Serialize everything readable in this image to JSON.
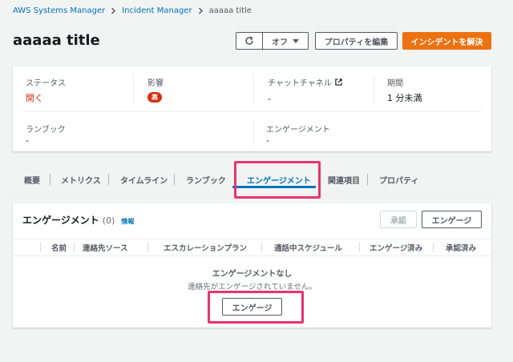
{
  "breadcrumb": {
    "root": "AWS Systems Manager",
    "parent": "Incident Manager",
    "current": "aaaaa title"
  },
  "page": {
    "title": "aaaaa title"
  },
  "toolbar": {
    "off_label": "オフ",
    "properties_label": "プロパティを編集",
    "resolve_label": "インシデントを解決"
  },
  "summary": {
    "status_label": "ステータス",
    "status_value": "開く",
    "impact_label": "影響",
    "impact_value": "高",
    "chat_label": "チャットチャネル",
    "chat_value": "-",
    "duration_label": "期間",
    "duration_value": "1 分未満",
    "runbook_label": "ランブック",
    "runbook_value": "-",
    "engagement_label": "エンゲージメント",
    "engagement_value": "-"
  },
  "tabs": [
    "概要",
    "メトリクス",
    "タイムライン",
    "ランブック",
    "エンゲージメント",
    "関連項目",
    "プロパティ"
  ],
  "engagements": {
    "title": "エンゲージメント",
    "count": "(0)",
    "info": "情報",
    "approve_label": "承認",
    "engage_label": "エンゲージ",
    "columns": [
      "名前",
      "連絡先ソース",
      "エスカレーションプラン",
      "通話中スケジュール",
      "エンゲージ済み",
      "承認済み"
    ],
    "empty_title": "エンゲージメントなし",
    "empty_desc": "連絡先がエンゲージされていません。",
    "empty_button": "エンゲージ"
  },
  "colors": {
    "accent": "#0073bb",
    "primary_button": "#ec7211",
    "status": "#d13212",
    "highlight": "#e9336f"
  }
}
